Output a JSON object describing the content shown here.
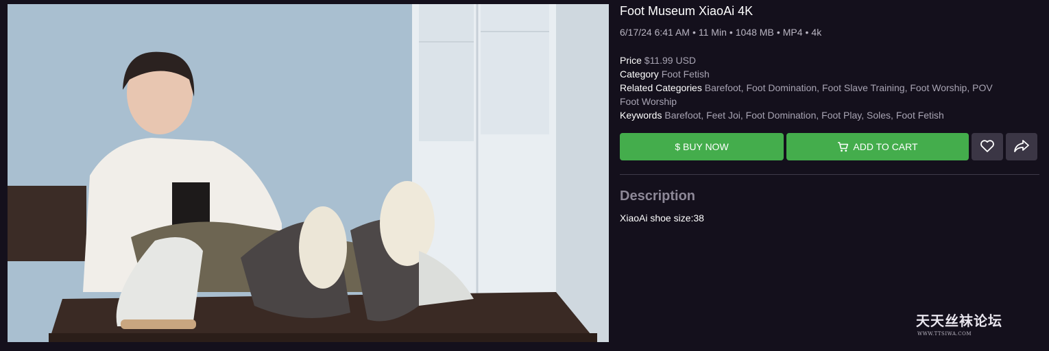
{
  "product": {
    "title": "Foot Museum XiaoAi 4K",
    "meta": {
      "date": "6/17/24 6:41 AM",
      "duration": "11 Min",
      "size": "1048 MB",
      "format": "MP4",
      "resolution": "4k",
      "separator": "•"
    },
    "price_label": "Price",
    "price_value": "$11.99 USD",
    "category_label": "Category",
    "category_value": "Foot Fetish",
    "related_label": "Related Categories",
    "related_value": "Barefoot, Foot Domination, Foot Slave Training, Foot Worship, POV Foot Worship",
    "keywords_label": "Keywords",
    "keywords_value": "Barefoot, Feet Joi, Foot Domination, Foot Play, Soles, Foot Fetish"
  },
  "actions": {
    "buy_label": "$ BUY NOW",
    "cart_label": "ADD TO CART",
    "favorite_icon": "heart-icon",
    "share_icon": "share-icon",
    "cart_icon": "cart-icon",
    "button_color": "#44ad4c"
  },
  "description": {
    "heading": "Description",
    "text": "XiaoAi shoe size:38"
  },
  "watermark": {
    "chinese": "天天丝袜论坛",
    "url": "WWW.TTSIWA.COM"
  }
}
